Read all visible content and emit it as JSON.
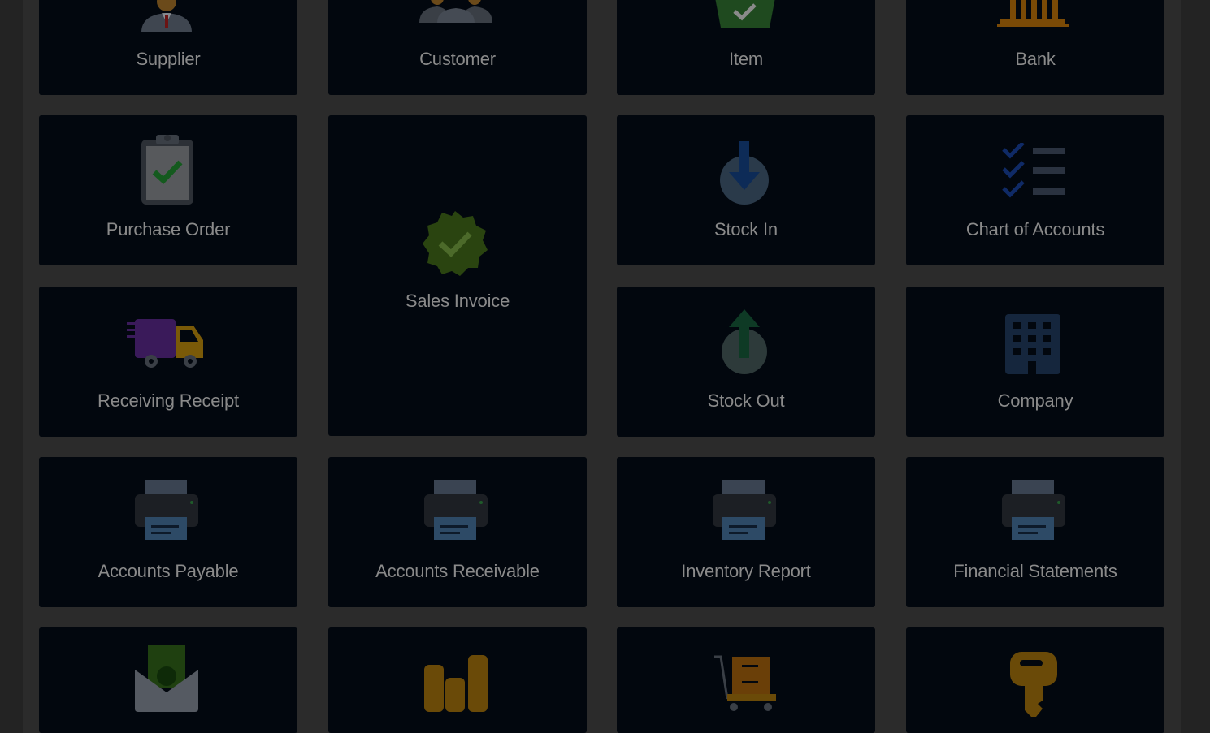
{
  "tiles": {
    "supplier": {
      "label": "Supplier",
      "icon": "supplier-person-icon"
    },
    "customer": {
      "label": "Customer",
      "icon": "customer-group-icon"
    },
    "item": {
      "label": "Item",
      "icon": "item-box-check-icon"
    },
    "bank": {
      "label": "Bank",
      "icon": "bank-building-icon"
    },
    "purchase_order": {
      "label": "Purchase Order",
      "icon": "clipboard-check-icon"
    },
    "sales_invoice": {
      "label": "Sales Invoice",
      "icon": "verified-badge-icon"
    },
    "stock_in": {
      "label": "Stock In",
      "icon": "arrow-down-circle-icon"
    },
    "chart_of_accounts": {
      "label": "Chart of Accounts",
      "icon": "checklist-icon"
    },
    "receiving_receipt": {
      "label": "Receiving Receipt",
      "icon": "delivery-truck-icon"
    },
    "stock_out": {
      "label": "Stock Out",
      "icon": "arrow-up-circle-icon"
    },
    "company": {
      "label": "Company",
      "icon": "office-building-icon"
    },
    "accounts_payable": {
      "label": "Accounts Payable",
      "icon": "printer-icon"
    },
    "accounts_receivable": {
      "label": "Accounts Receivable",
      "icon": "printer-icon"
    },
    "inventory_report": {
      "label": "Inventory Report",
      "icon": "printer-icon"
    },
    "financial_statements": {
      "label": "Financial Statements",
      "icon": "printer-icon"
    },
    "row5_col1": {
      "icon": "money-envelope-icon"
    },
    "row5_col2": {
      "icon": "coin-stacks-icon"
    },
    "row5_col3": {
      "icon": "cabinet-cart-icon"
    },
    "row5_col4": {
      "icon": "key-icon"
    }
  }
}
